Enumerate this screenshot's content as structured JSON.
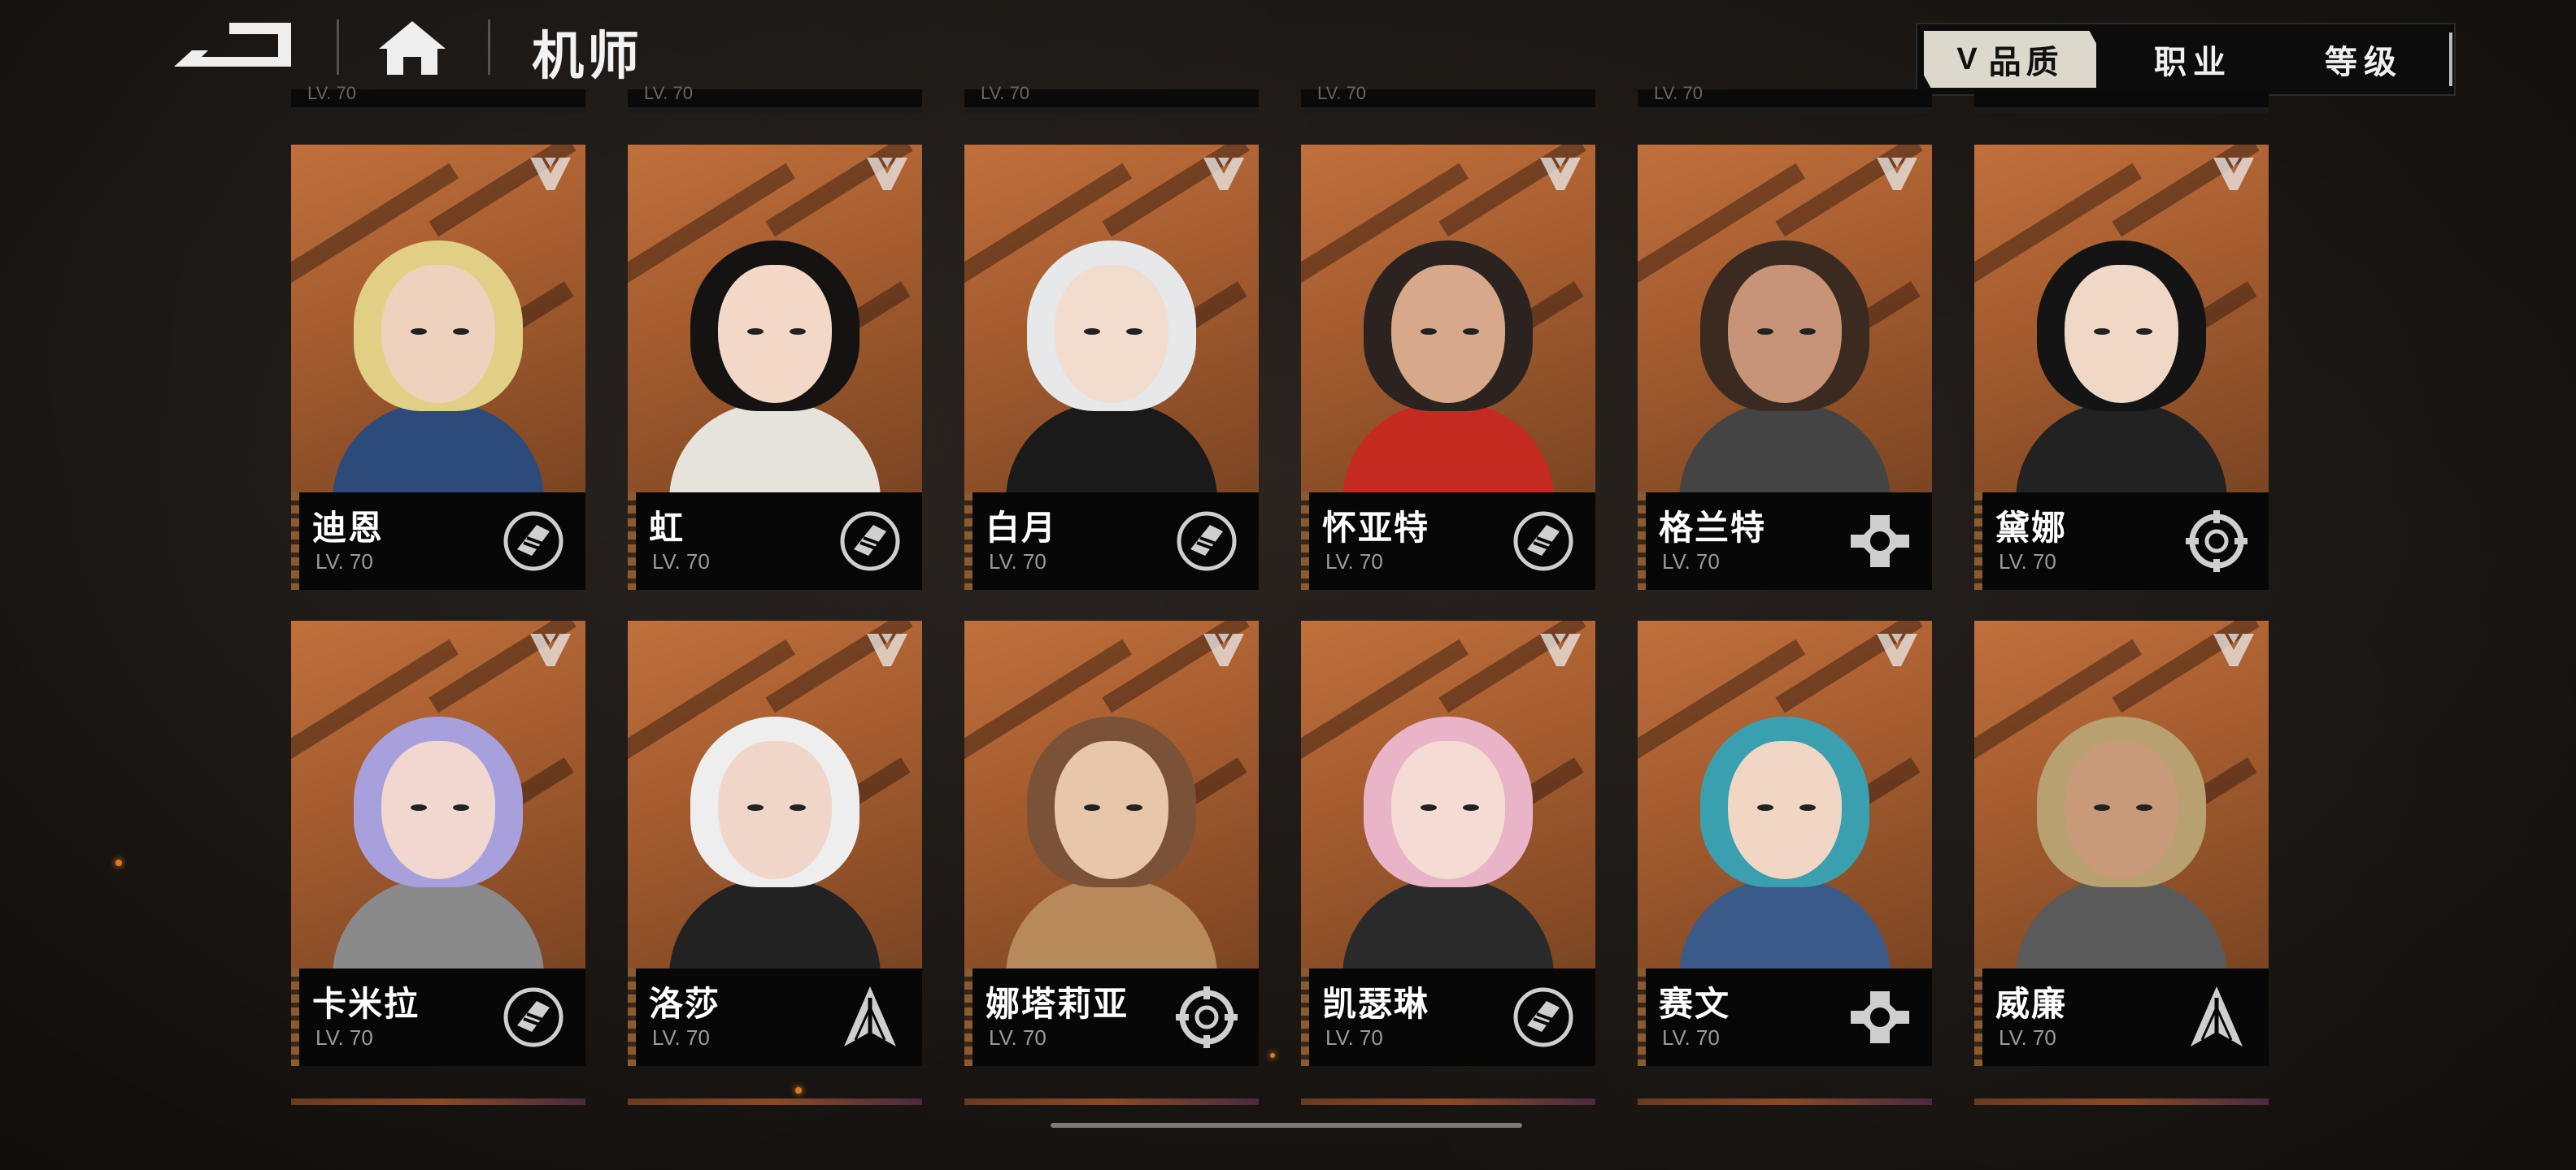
{
  "page": {
    "title": "机师"
  },
  "filters": {
    "active_label": "品质",
    "chevron": "V",
    "items": [
      "职业",
      "等级"
    ]
  },
  "colors": {
    "accent": "#b86a38",
    "card_bg": "#070707"
  },
  "top_row_partial": [
    {
      "level": "LV. 70"
    },
    {
      "level": "LV. 70"
    },
    {
      "level": "LV. 70"
    },
    {
      "level": "LV. 70"
    },
    {
      "level": "LV. 70"
    },
    {
      "level": ""
    }
  ],
  "pilots": [
    {
      "name": "迪恩",
      "level": "LV. 70",
      "class_icon": "fist-icon"
    },
    {
      "name": "虹",
      "level": "LV. 70",
      "class_icon": "fist-icon"
    },
    {
      "name": "白月",
      "level": "LV. 70",
      "class_icon": "fist-icon"
    },
    {
      "name": "怀亚特",
      "level": "LV. 70",
      "class_icon": "fist-icon"
    },
    {
      "name": "格兰特",
      "level": "LV. 70",
      "class_icon": "wrench-icon"
    },
    {
      "name": "黛娜",
      "level": "LV. 70",
      "class_icon": "target-icon"
    },
    {
      "name": "卡米拉",
      "level": "LV. 70",
      "class_icon": "fist-icon"
    },
    {
      "name": "洛莎",
      "level": "LV. 70",
      "class_icon": "spear-icon"
    },
    {
      "name": "娜塔莉亚",
      "level": "LV. 70",
      "class_icon": "target-icon"
    },
    {
      "name": "凯瑟琳",
      "level": "LV. 70",
      "class_icon": "fist-icon"
    },
    {
      "name": "赛文",
      "level": "LV. 70",
      "class_icon": "wrench-icon"
    },
    {
      "name": "威廉",
      "level": "LV. 70",
      "class_icon": "spear-icon"
    }
  ]
}
